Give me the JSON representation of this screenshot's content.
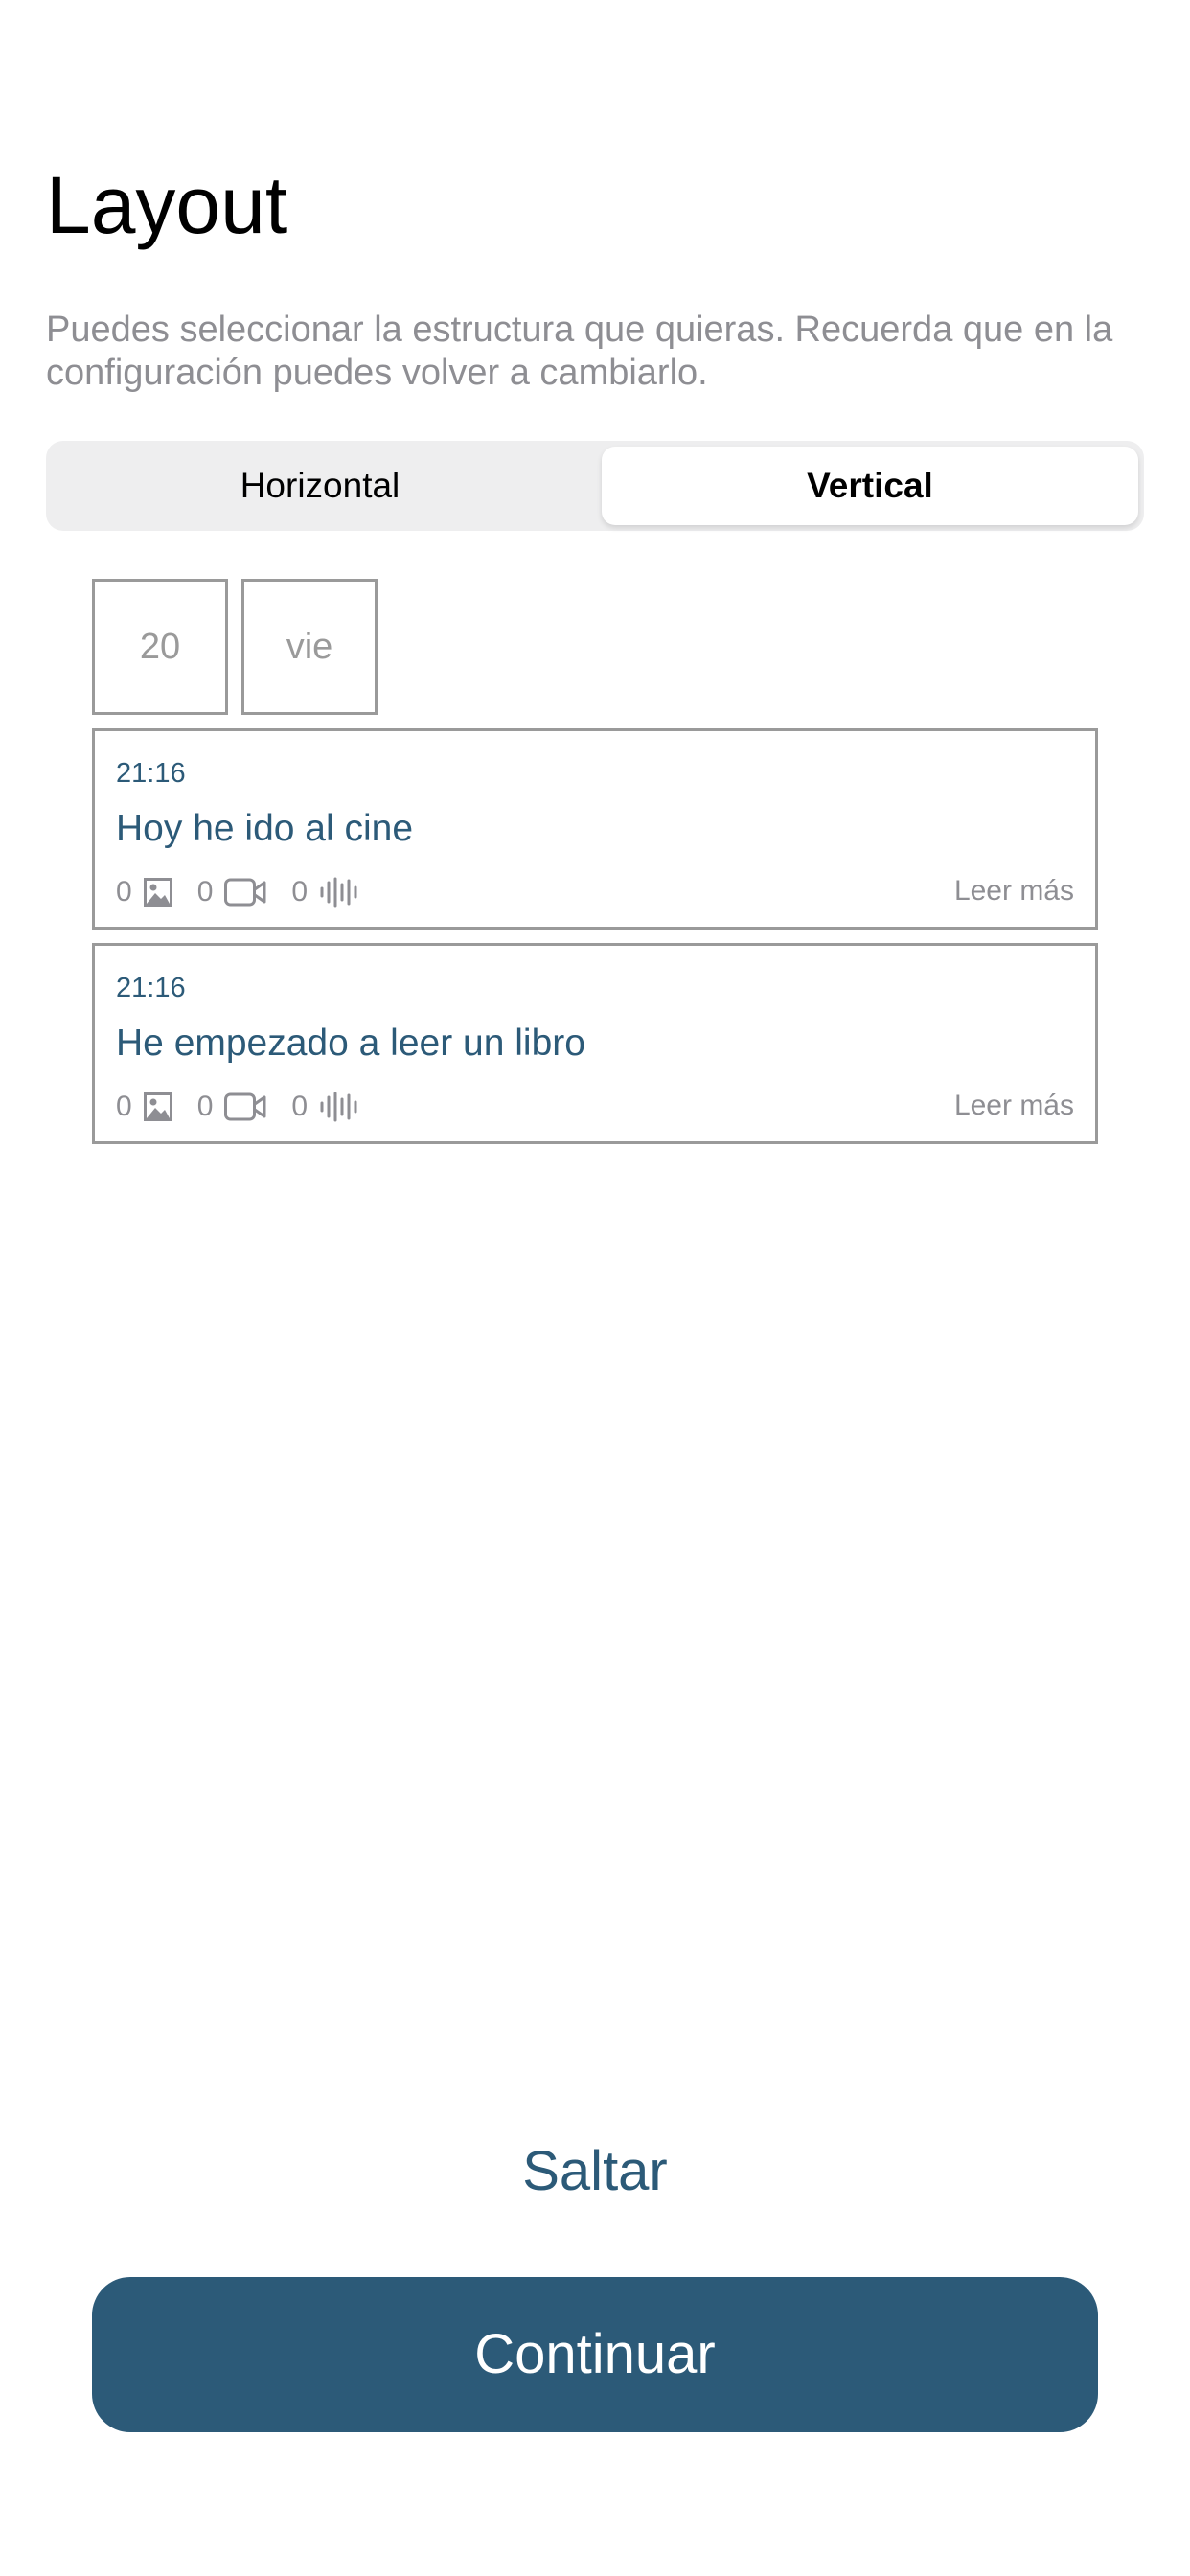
{
  "header": {
    "title": "Layout",
    "subtitle": "Puedes seleccionar la estructura que quieras. Recuerda que en la configuración puedes volver a cambiarlo."
  },
  "layout_toggle": {
    "options": [
      "Horizontal",
      "Vertical"
    ],
    "selected": "Vertical"
  },
  "preview": {
    "day_number": "20",
    "day_name": "vie",
    "entries": [
      {
        "time": "21:16",
        "title": "Hoy he ido al cine",
        "photos": "0",
        "videos": "0",
        "audios": "0",
        "read_more": "Leer más"
      },
      {
        "time": "21:16",
        "title": "He empezado a leer un libro",
        "photos": "0",
        "videos": "0",
        "audios": "0",
        "read_more": "Leer más"
      }
    ]
  },
  "actions": {
    "skip": "Saltar",
    "continue": "Continuar"
  },
  "colors": {
    "accent": "#2c5a78",
    "muted": "#8e8e93",
    "border": "#9a9a9a",
    "segment_bg": "#eeeeef"
  },
  "icons": {
    "photo": "image-icon",
    "video": "video-camera-icon",
    "audio": "audio-wave-icon"
  }
}
